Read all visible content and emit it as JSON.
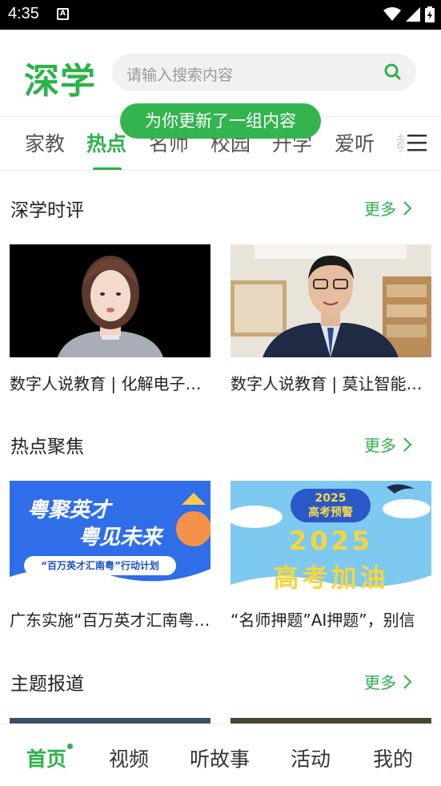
{
  "status_bar": {
    "time": "4:35"
  },
  "header": {
    "logo": "深学",
    "search_placeholder": "请输入搜索内容"
  },
  "tabs": [
    "家教",
    "热点",
    "名师",
    "校园",
    "升学",
    "爱听",
    "教"
  ],
  "active_tab": "热点",
  "toast": "为你更新了一组内容",
  "sections": [
    {
      "title": "深学时评",
      "more": "更多",
      "cards": [
        {
          "title": "数字人说教育 | 化解电子产品依赖"
        },
        {
          "title": "数字人说教育 | 莫让智能工具"
        }
      ]
    },
    {
      "title": "热点聚焦",
      "more": "更多",
      "cards": [
        {
          "title": "广东实施“百万英才汇南粤”行动计划"
        },
        {
          "title": "“名师押题”AI押题”，别信"
        }
      ]
    },
    {
      "title": "主题报道",
      "more": "更多",
      "cards": []
    }
  ],
  "banner1": {
    "line1": "粤聚英才",
    "line2": "粤见未来",
    "pill": "“百万英才汇南粤”行动计划"
  },
  "banner2": {
    "badge_year": "2025",
    "badge_text": "高考预警",
    "big_year": "2025",
    "big_text": "高考加油"
  },
  "bottom_nav": [
    "首页",
    "视频",
    "听故事",
    "活动",
    "我的"
  ],
  "colors": {
    "accent": "#2db24a"
  }
}
